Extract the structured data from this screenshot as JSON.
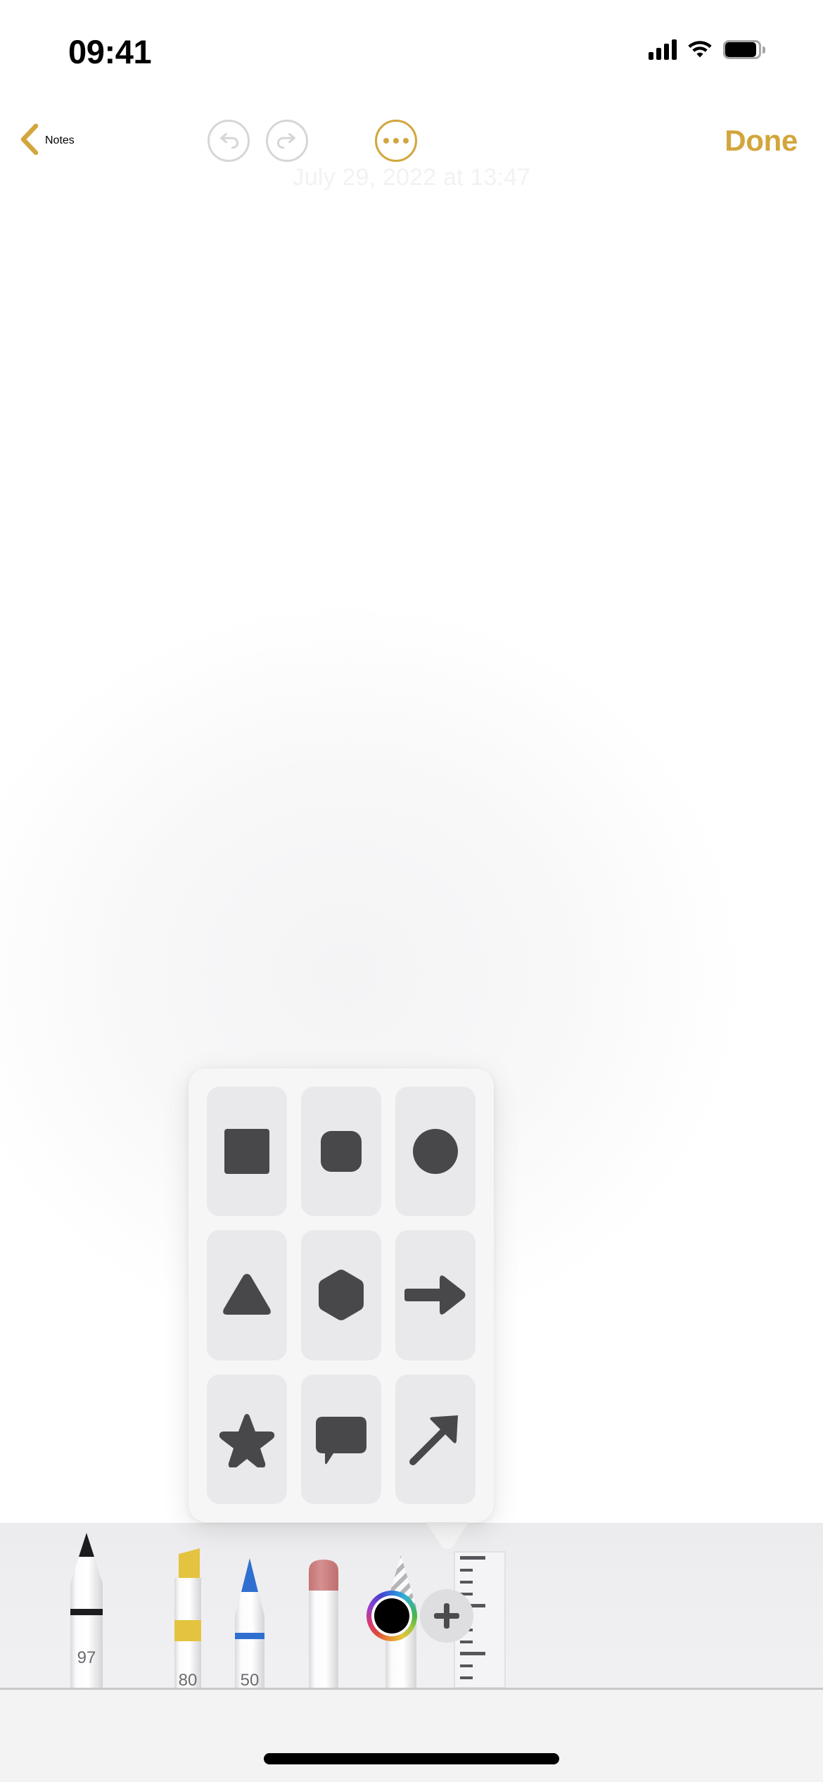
{
  "status_bar": {
    "time": "09:41",
    "cellular_icon": "cellular-bars-icon",
    "wifi_icon": "wifi-icon",
    "battery_icon": "battery-icon"
  },
  "nav_bar": {
    "back_label": "Notes",
    "back_icon": "chevron-left-icon",
    "undo_icon": "undo-arrow-icon",
    "redo_icon": "redo-arrow-icon",
    "more_icon": "ellipsis-circle-icon",
    "done_label": "Done",
    "accent_color": "#D2A63C",
    "disabled_color": "#D6D6D8"
  },
  "note": {
    "date_text": "July 29, 2022 at 13:47"
  },
  "shapes_popover": {
    "tile_background": "#E9E9EB",
    "panel_background": "#F6F6F7",
    "shape_color": "#48484A",
    "shapes": [
      {
        "name": "square",
        "icon": "square-shape-icon"
      },
      {
        "name": "rounded-square",
        "icon": "rounded-square-shape-icon"
      },
      {
        "name": "circle",
        "icon": "circle-shape-icon"
      },
      {
        "name": "triangle",
        "icon": "triangle-shape-icon"
      },
      {
        "name": "hexagon",
        "icon": "hexagon-shape-icon"
      },
      {
        "name": "arrow-right",
        "icon": "arrow-right-shape-icon"
      },
      {
        "name": "star",
        "icon": "star-shape-icon"
      },
      {
        "name": "speech-bubble",
        "icon": "speech-bubble-shape-icon"
      },
      {
        "name": "diagonal-arrow",
        "icon": "diagonal-arrow-shape-icon"
      }
    ]
  },
  "tool_palette": {
    "tools": [
      {
        "name": "pen",
        "opacity": "97",
        "color": "#1C1C1E"
      },
      {
        "name": "highlighter",
        "opacity": "80",
        "color": "#E3C33F"
      },
      {
        "name": "pencil",
        "opacity": "50",
        "color": "#2F6FD0"
      },
      {
        "name": "eraser",
        "opacity": "",
        "color": "#CF8080"
      },
      {
        "name": "lasso",
        "opacity": "",
        "color": "#B5B5B8"
      },
      {
        "name": "ruler",
        "opacity": "",
        "color": "#55555A"
      }
    ],
    "color_wheel": {
      "name": "color-picker",
      "selected_color": "#000000"
    },
    "add_button": {
      "name": "add-tool",
      "label": "+"
    }
  },
  "home_bar": {
    "indicator": "home-indicator"
  }
}
